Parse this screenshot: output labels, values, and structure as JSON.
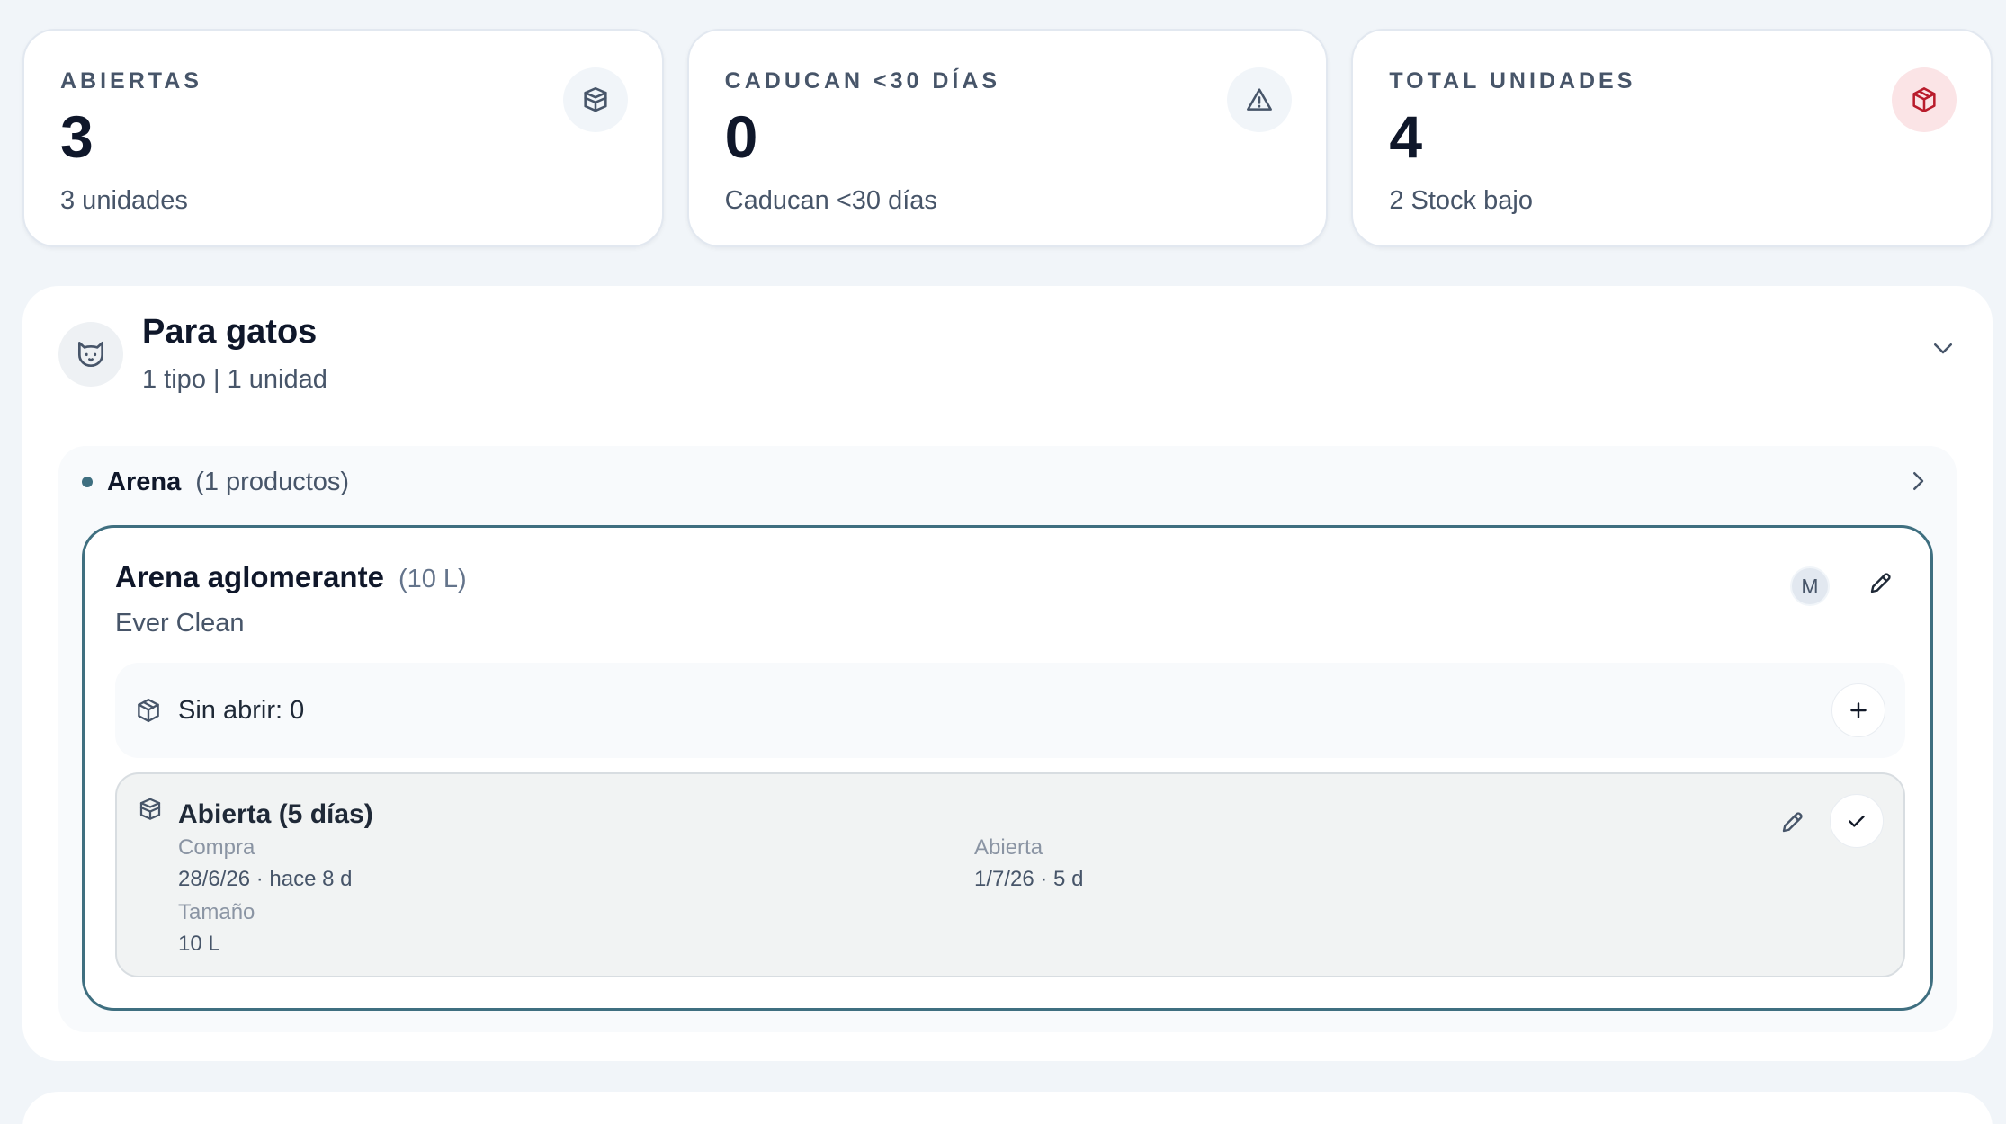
{
  "stats": [
    {
      "label": "ABIERTAS",
      "value": "3",
      "sub": "3 unidades",
      "icon": "open-boxes-icon"
    },
    {
      "label": "CADUCAN <30 DÍAS",
      "value": "0",
      "sub": "Caducan <30 días",
      "icon": "warning-triangle-icon"
    },
    {
      "label": "TOTAL UNIDADES",
      "value": "4",
      "sub": "2 Stock bajo",
      "icon": "package-icon",
      "icon_color": "#b91c2c"
    }
  ],
  "category": {
    "title": "Para gatos",
    "subtitle": "1 tipo | 1 unidad",
    "icon": "cat-icon"
  },
  "subcategory": {
    "name": "Arena",
    "count": "(1 productos)"
  },
  "product": {
    "name": "Arena aglomerante",
    "size": "(10 L)",
    "brand": "Ever Clean",
    "owner_initial": "M",
    "unopened_label": "Sin abrir: 0",
    "opened": {
      "title": "Abierta (5 días)",
      "purchase_label": "Compra",
      "purchase_value": "28/6/26 · hace 8 d",
      "opened_label": "Abierta",
      "opened_value": "1/7/26 · 5 d",
      "size_label": "Tamaño",
      "size_value": "10 L"
    }
  },
  "colors": {
    "accent": "#3f6f80",
    "alert": "#b91c2c",
    "background": "#f1f5f9"
  }
}
